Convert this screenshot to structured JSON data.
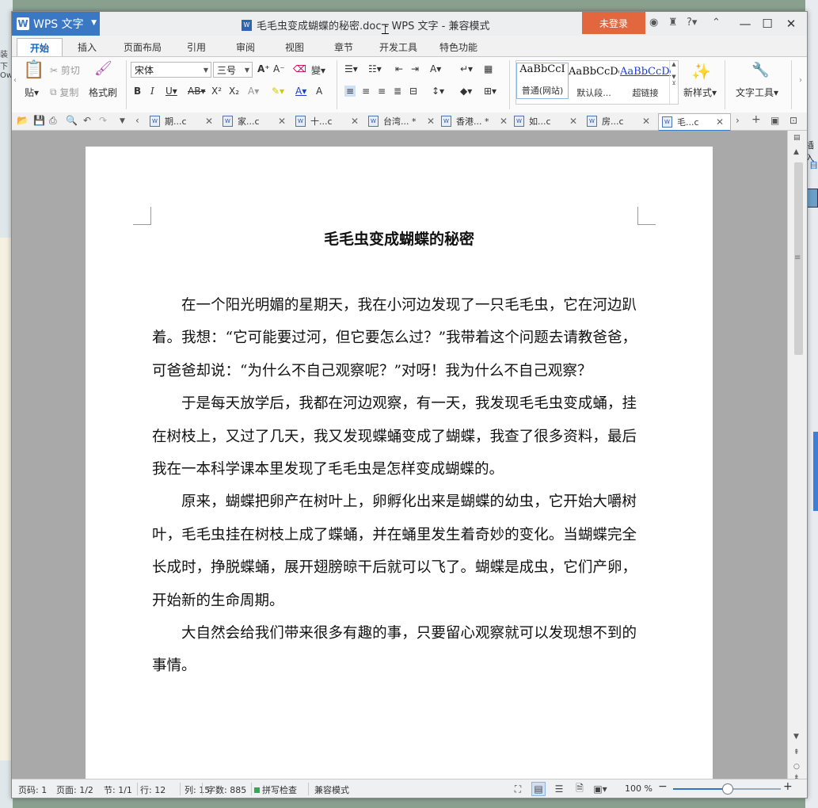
{
  "window": {
    "app_name": "WPS 文字",
    "title": "毛毛虫变成蝴蝶的秘密.doc - WPS 文字 - 兼容模式",
    "login_label": "未登录",
    "help_label": "?"
  },
  "menu_tabs": [
    "开始",
    "插入",
    "页面布局",
    "引用",
    "审阅",
    "视图",
    "章节",
    "开发工具",
    "特色功能"
  ],
  "ribbon": {
    "paste_label": "贴",
    "cut_label": "剪切",
    "copy_label": "复制",
    "format_painter_label": "格式刷",
    "font_name": "宋体",
    "font_size": "三号",
    "styles": [
      {
        "preview": "AaBbCcI",
        "label": "普通(网站)"
      },
      {
        "preview": "AaBbCcDd",
        "label": "默认段..."
      },
      {
        "preview": "AaBbCcDd",
        "label": "超链接"
      }
    ],
    "new_style_label": "新样式",
    "text_tools_label": "文字工具"
  },
  "doc_tabs": [
    {
      "label": "期...c",
      "modified": false
    },
    {
      "label": "家...c",
      "modified": false
    },
    {
      "label": "十...c",
      "modified": false
    },
    {
      "label": "台湾... *",
      "modified": true
    },
    {
      "label": "香港... *",
      "modified": true
    },
    {
      "label": "如...c",
      "modified": false
    },
    {
      "label": "房...c",
      "modified": false
    },
    {
      "label": "毛...c",
      "modified": false,
      "active": true
    }
  ],
  "document": {
    "heading": "毛毛虫变成蝴蝶的秘密",
    "paragraphs": [
      "在一个阳光明媚的星期天，我在小河边发现了一只毛毛虫，它在河边趴着。我想：“它可能要过河，但它要怎么过？”我带着这个问题去请教爸爸，可爸爸却说：“为什么不自己观察呢？”对呀！我为什么不自己观察？",
      "于是每天放学后，我都在河边观察，有一天，我发现毛毛虫变成蛹，挂在树枝上，又过了几天，我又发现蝶蛹变成了蝴蝶，我查了很多资料，最后我在一本科学课本里发现了毛毛虫是怎样变成蝴蝶的。",
      "原来，蝴蝶把卵产在树叶上，卵孵化出来是蝴蝶的幼虫，它开始大嚼树叶，毛毛虫挂在树枝上成了蝶蛹，并在蛹里发生着奇妙的变化。当蝴蝶完全长成时，挣脱蝶蛹，展开翅膀晾干后就可以飞了。蝴蝶是成虫，它们产卵，开始新的生命周期。",
      "大自然会给我们带来很多有趣的事，只要留心观察就可以发现想不到的事情。"
    ]
  },
  "status": {
    "page_code": "页码: 1",
    "page": "页面: 1/2",
    "section": "节: 1/1",
    "row": "行: 12",
    "col": "列: 15",
    "word_count": "字数: 885",
    "spell_check": "拼写检查",
    "compat_mode": "兼容模式",
    "zoom": "100 %",
    "zoom_fraction": 0.5
  },
  "colors": {
    "accent_blue": "#3b78c4",
    "login_orange": "#e2673f"
  }
}
